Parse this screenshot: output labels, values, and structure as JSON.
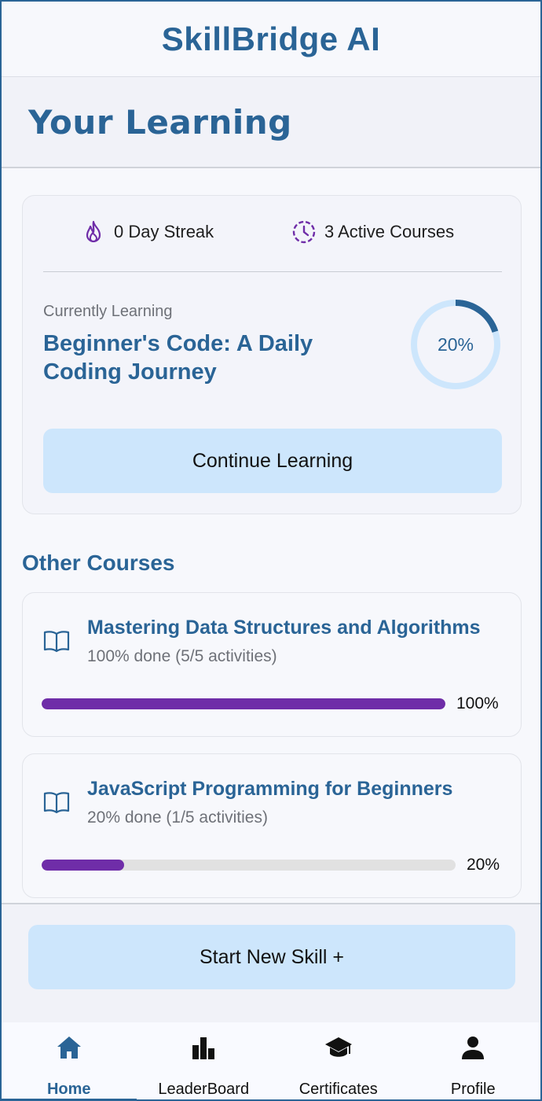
{
  "app": {
    "title": "SkillBridge AI"
  },
  "page": {
    "title": "Your Learning"
  },
  "stats": {
    "streak_text": "0 Day Streak",
    "streak_icon": "flame-icon",
    "active_text": "3 Active Courses",
    "active_icon": "clock-icon",
    "icon_color": "#6f2da8"
  },
  "current_course": {
    "label": "Currently Learning",
    "title": "Beginner's Code: A Daily Coding Journey",
    "progress_text": "20%",
    "progress": 0.2,
    "ring_colors": {
      "track": "#cde6fc",
      "fill": "#2a6496"
    },
    "continue_label": "Continue Learning"
  },
  "other_courses": {
    "title": "Other Courses",
    "items": [
      {
        "title": "Mastering Data Structures and Algorithms",
        "subtitle": "100% done (5/5 activities)",
        "progress": 1.0,
        "percent_label": "100%",
        "icon": "book-icon"
      },
      {
        "title": "JavaScript Programming for Beginners",
        "subtitle": "20% done (1/5 activities)",
        "progress": 0.2,
        "percent_label": "20%",
        "icon": "book-icon"
      }
    ]
  },
  "actions": {
    "new_skill_label": "Start New Skill +"
  },
  "nav": {
    "items": [
      {
        "label": "Home",
        "icon": "home-icon",
        "active": true
      },
      {
        "label": "LeaderBoard",
        "icon": "leaderboard-icon",
        "active": false
      },
      {
        "label": "Certificates",
        "icon": "graduation-cap-icon",
        "active": false
      },
      {
        "label": "Profile",
        "icon": "person-icon",
        "active": false
      }
    ]
  },
  "colors": {
    "primary": "#2a6496",
    "accent": "#6f2da8",
    "button_bg": "#cde6fc",
    "background": "#f7f8fc"
  }
}
